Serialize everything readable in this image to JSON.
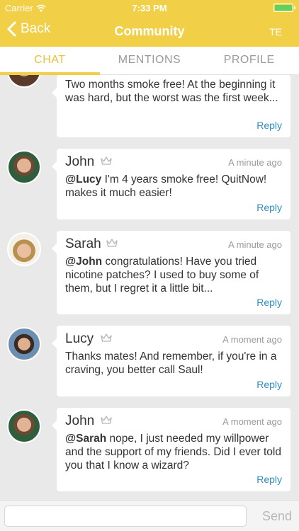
{
  "status_bar": {
    "carrier": "Carrier",
    "time": "7:33 PM"
  },
  "nav": {
    "back_label": "Back",
    "title": "Community",
    "right_label": "TE"
  },
  "tabs": [
    {
      "label": "CHAT"
    },
    {
      "label": "MENTIONS"
    },
    {
      "label": "PROFILE"
    }
  ],
  "messages": [
    {
      "name": "",
      "timestamp": "",
      "mention": "",
      "text": "Two months smoke free! At the beginning it was hard, but the worst was the first week...",
      "reply_label": "Reply"
    },
    {
      "name": "John",
      "timestamp": "A minute ago",
      "mention": "@Lucy",
      "text": " I'm 4 years smoke free! QuitNow! makes it much easier!",
      "reply_label": "Reply"
    },
    {
      "name": "Sarah",
      "timestamp": "A minute ago",
      "mention": "@John",
      "text": " congratulations! Have you tried nicotine patches? I used to buy some of them, but I regret it a little bit...",
      "reply_label": "Reply"
    },
    {
      "name": "Lucy",
      "timestamp": "A moment ago",
      "mention": "",
      "text": "Thanks mates! And remember, if you're in a craving, you better call Saul!",
      "reply_label": "Reply"
    },
    {
      "name": "John",
      "timestamp": "A moment ago",
      "mention": "@Sarah",
      "text": " nope, I just needed my willpower and the support of my friends. Did I ever told you that I know a wizard?",
      "reply_label": "Reply"
    }
  ],
  "composer": {
    "placeholder": "",
    "send_label": "Send"
  },
  "colors": {
    "accent": "#f1cf47",
    "tab_active": "#e8c23a",
    "link": "#2f8cc0"
  }
}
